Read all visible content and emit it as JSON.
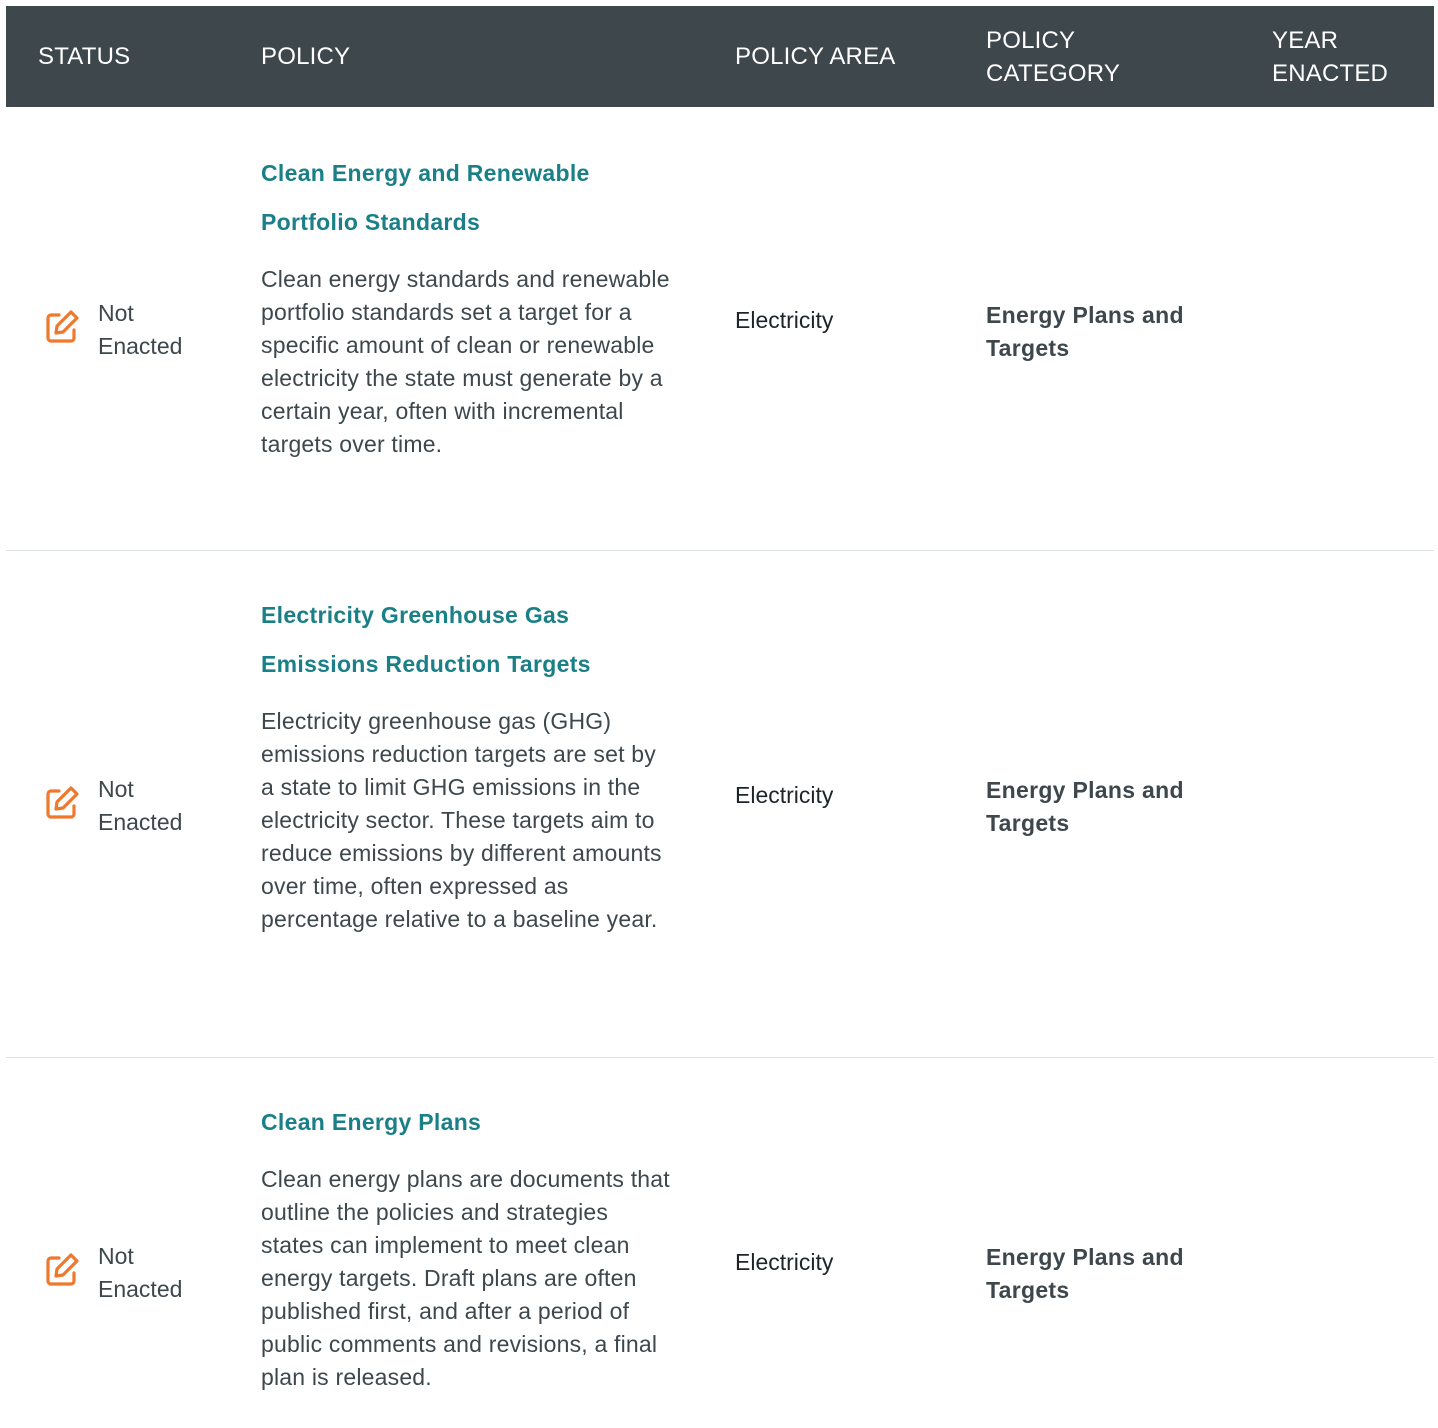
{
  "header": {
    "status": "STATUS",
    "policy": "POLICY",
    "policy_area": "POLICY AREA",
    "policy_category": "POLICY CATEGORY",
    "year_enacted": "YEAR ENACTED"
  },
  "colors": {
    "header_bg": "#3d474c",
    "title_link": "#1a7f87",
    "status_icon": "#f0782d",
    "divider": "#dde2e5"
  },
  "rows": [
    {
      "status": "Not Enacted",
      "status_icon": "edit-pencil-icon",
      "title": "Clean Energy and Renewable Portfolio Standards",
      "description": "Clean energy standards and renewable portfolio standards set a target for a specific amount of clean or renewable electricity the state must generate by a certain year, often with incremental targets over time.",
      "policy_area": "Electricity",
      "policy_category": "Energy Plans and Targets",
      "year_enacted": ""
    },
    {
      "status": "Not Enacted",
      "status_icon": "edit-pencil-icon",
      "title": "Electricity Greenhouse Gas Emissions Reduction Targets",
      "description": "Electricity greenhouse gas (GHG) emissions reduction targets are set by a state to limit GHG emissions in the electricity sector. These targets aim to reduce emissions by different amounts over time, often expressed as percentage relative to a baseline year.",
      "policy_area": "Electricity",
      "policy_category": "Energy Plans and Targets",
      "year_enacted": ""
    },
    {
      "status": "Not Enacted",
      "status_icon": "edit-pencil-icon",
      "title": "Clean Energy Plans",
      "description": "Clean energy plans are documents that outline the policies and strategies states can implement to meet clean energy targets. Draft plans are often published first, and after a period of public comments and revisions, a final plan is released.",
      "policy_area": "Electricity",
      "policy_category": "Energy Plans and Targets",
      "year_enacted": ""
    }
  ]
}
